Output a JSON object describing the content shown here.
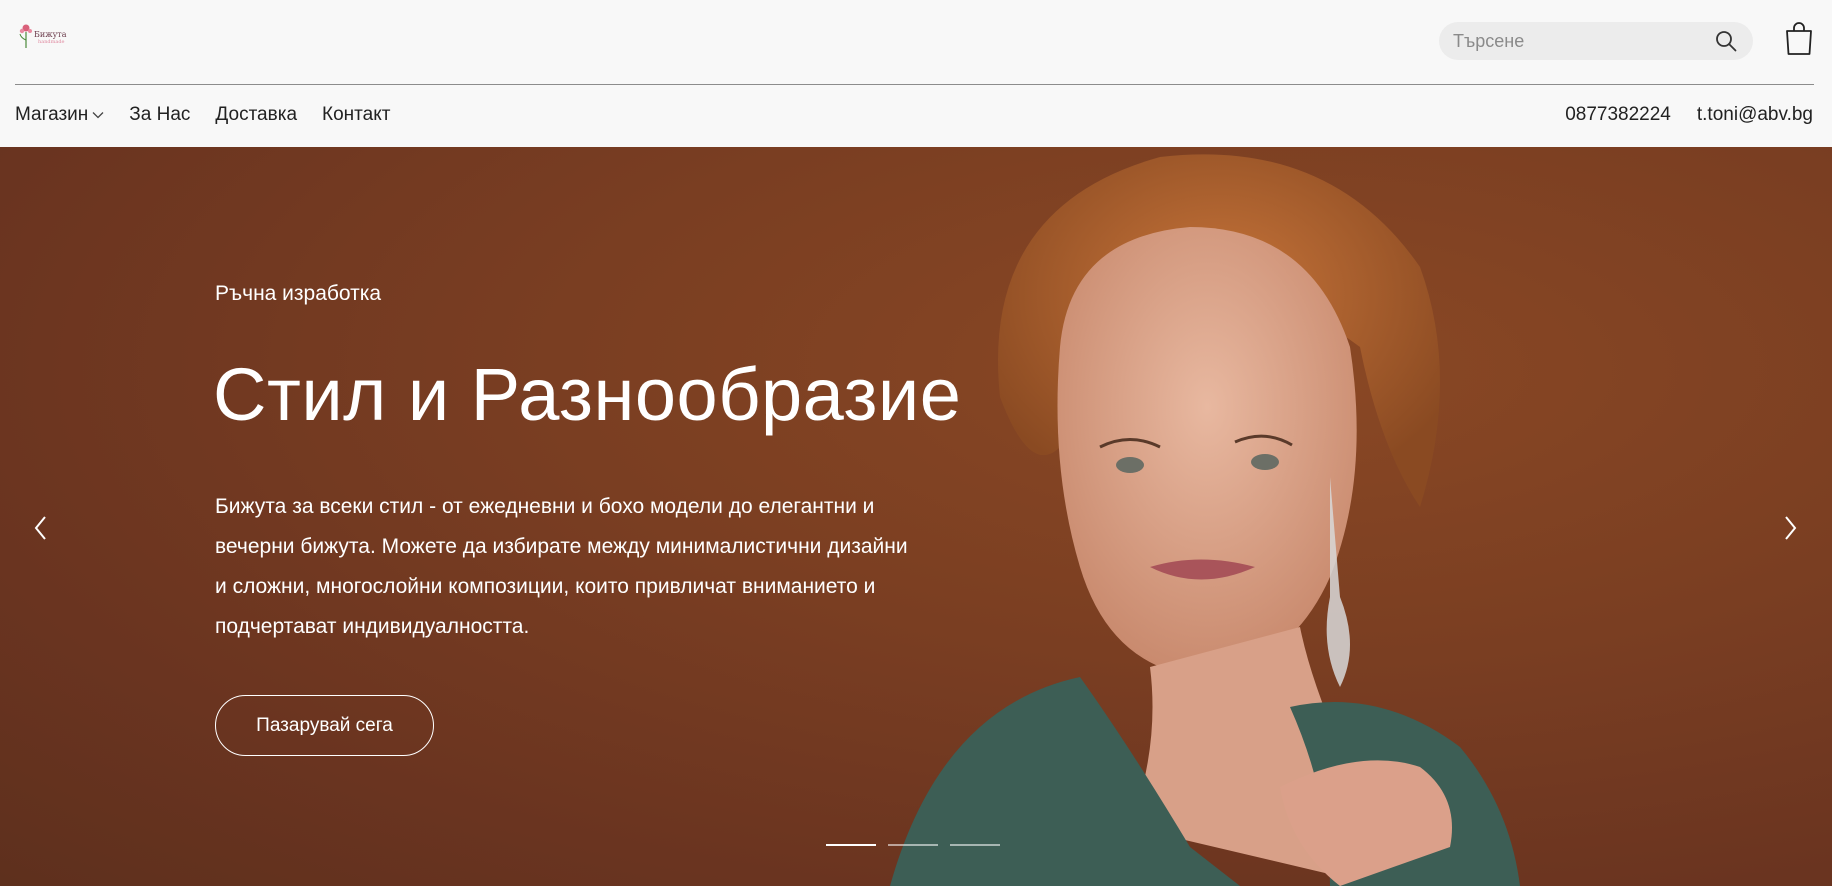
{
  "brand": {
    "logo_text": "Бижута",
    "logo_subtext": "handmade"
  },
  "search": {
    "placeholder": "Търсене",
    "value": ""
  },
  "nav": {
    "items": [
      {
        "label": "Магазин",
        "has_dropdown": true
      },
      {
        "label": "За Нас"
      },
      {
        "label": "Доставка"
      },
      {
        "label": "Контакт"
      }
    ]
  },
  "contact": {
    "phone": "0877382224",
    "email": "t.toni@abv.bg"
  },
  "hero": {
    "kicker": "Ръчна изработка",
    "title": "Стил и Разнообразие",
    "text": "Бижута за всеки стил - от ежедневни и бохо модели до елегантни и вечерни бижута. Можете да избирате между минималистични дизайни и сложни, многослойни композиции, които привличат вниманието и подчертават индивидуалността.",
    "cta_label": "Пазарувай сега",
    "slides_total": 3,
    "active_slide": 1
  },
  "colors": {
    "background": "#f8f8f8",
    "hero_brown": "#7a3e22",
    "text_dark": "#222222",
    "text_light": "#ffffff"
  },
  "icons": [
    "search-icon",
    "shopping-bag-icon",
    "chevron-down-icon",
    "chevron-left-icon",
    "chevron-right-icon"
  ]
}
